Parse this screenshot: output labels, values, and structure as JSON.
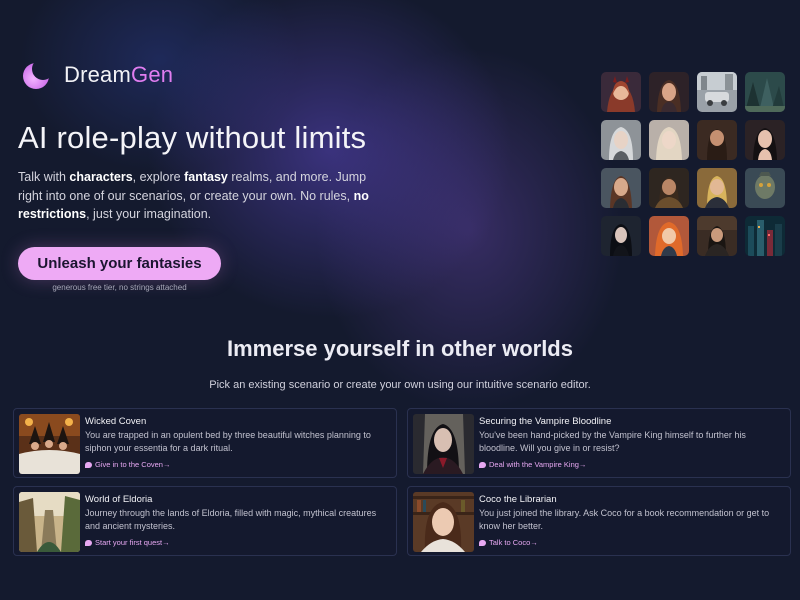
{
  "brand": {
    "name_a": "Dream",
    "name_b": "Gen"
  },
  "hero": {
    "headline": "AI role-play without limits",
    "intro": [
      {
        "t": "Talk with ",
        "b": false
      },
      {
        "t": "characters",
        "b": true
      },
      {
        "t": ", explore ",
        "b": false
      },
      {
        "t": "fantasy",
        "b": true
      },
      {
        "t": " realms, and more. Jump right into one of our scenarios, or create your own. No rules, ",
        "b": false
      },
      {
        "t": "no restrictions",
        "b": true
      },
      {
        "t": ", just your imagination.",
        "b": false
      }
    ],
    "cta_label": "Unleash your fantasies",
    "cta_note": "generous free tier, no strings attached"
  },
  "gallery": {
    "tiles": [
      "demon-girl-portrait",
      "woman-portrait",
      "ruined-car-scene",
      "forest-scene",
      "elf-portrait",
      "blonde-woman-portrait",
      "bearded-man-portrait",
      "dark-hair-woman-portrait",
      "woman-portrait-2",
      "warrior-man-portrait",
      "blonde-man-portrait",
      "cyborg-portrait",
      "goth-girl-portrait",
      "red-hair-girl-portrait",
      "man-in-library-portrait",
      "neon-city-scene"
    ]
  },
  "scenarios": {
    "title": "Immerse yourself in other worlds",
    "subtitle": "Pick an existing scenario or create your own using our intuitive scenario editor.",
    "cards": [
      {
        "title": "Wicked Coven",
        "desc": "You are trapped in an opulent bed by three beautiful witches planning to siphon your essentia for a dark ritual.",
        "link": "Give in to the Coven→"
      },
      {
        "title": "Securing the Vampire Bloodline",
        "desc": "You've been hand-picked by the Vampire King himself to further his bloodline. Will you give in or resist?",
        "link": "Deal with the Vampire King→"
      },
      {
        "title": "World of Eldoria",
        "desc": "Journey through the lands of Eldoria, filled with magic, mythical creatures and ancient mysteries.",
        "link": "Start your first quest→"
      },
      {
        "title": "Coco the Librarian",
        "desc": "You just joined the library. Ask Coco for a book recommendation or get to know her better.",
        "link": "Talk to Coco→"
      }
    ]
  },
  "colors": {
    "background": "#141a2e",
    "accent": "#e07df0",
    "cta": "#eeaaf5"
  }
}
